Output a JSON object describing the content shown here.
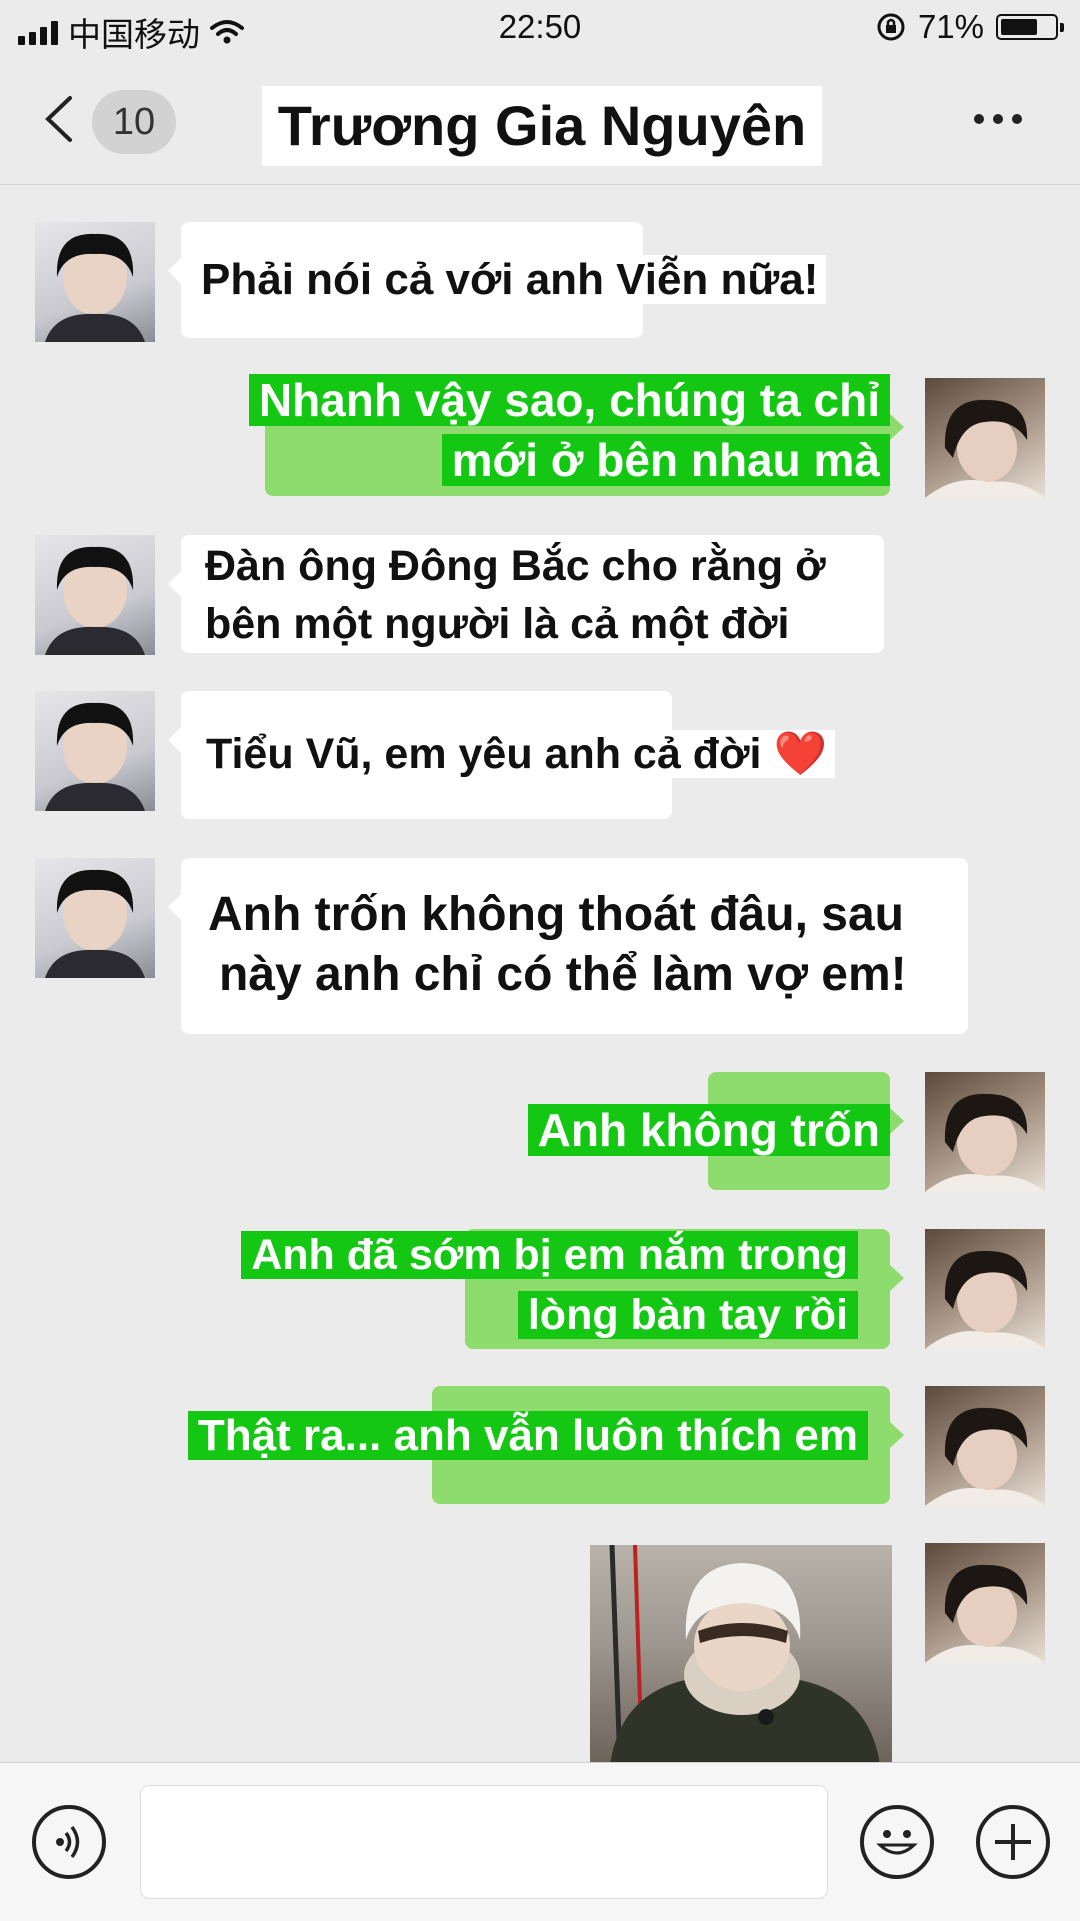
{
  "status": {
    "carrier": "中国移动",
    "time": "22:50",
    "battery": "71%",
    "battery_level": 0.71
  },
  "header": {
    "back_count": "10",
    "title": "Trương Gia Nguyên"
  },
  "messages": [
    {
      "side": "in",
      "lines": [
        "Phải nói cả với anh Viễn nữa!"
      ]
    },
    {
      "side": "out",
      "lines": [
        "Nhanh vậy sao, chúng ta chỉ",
        "mới ở bên nhau mà"
      ]
    },
    {
      "side": "in",
      "lines": [
        "Đàn ông Đông Bắc cho rằng ở",
        "bên một người là cả một đời"
      ]
    },
    {
      "side": "in",
      "lines": [
        "Tiểu Vũ, em yêu anh cả đời ❤️"
      ]
    },
    {
      "side": "in",
      "lines": [
        "Anh trốn không thoát đâu, sau",
        "này anh chỉ có thể làm vợ em!"
      ]
    },
    {
      "side": "out",
      "lines": [
        "Anh không trốn"
      ]
    },
    {
      "side": "out",
      "lines": [
        "Anh đã sớm bị em nắm trong",
        "lòng bàn tay rồi"
      ]
    },
    {
      "side": "out",
      "lines": [
        "Thật ra... anh vẫn luôn thích em"
      ]
    }
  ],
  "icons": {
    "voice": "voice-icon",
    "emoji": "emoji-icon",
    "add": "plus-icon",
    "back": "chevron-left-icon",
    "more": "more-icon"
  },
  "colors": {
    "sent_bubble": "#8edc6e",
    "highlight": "#13c713",
    "received_bubble": "#ffffff"
  }
}
